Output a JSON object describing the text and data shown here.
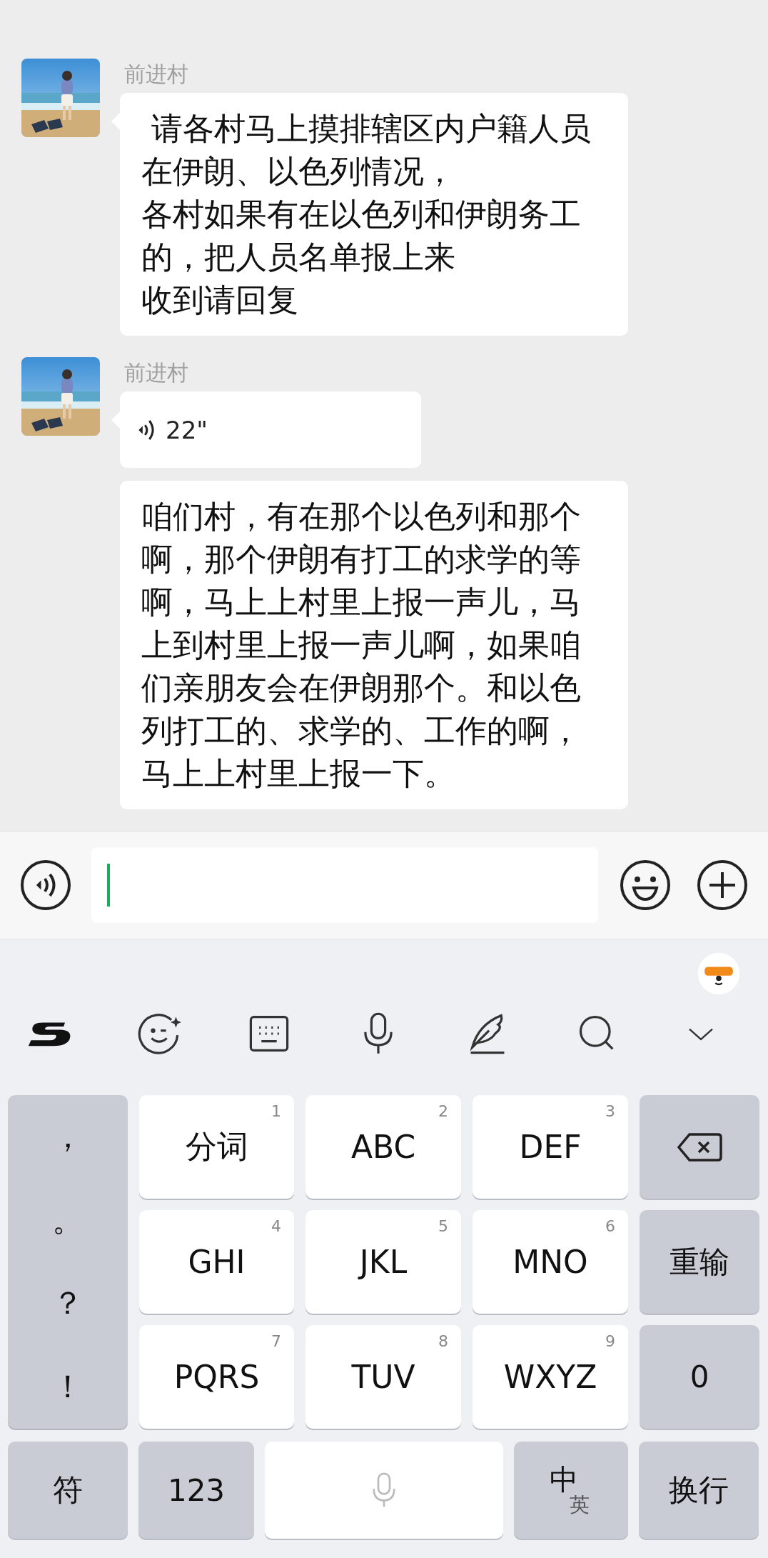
{
  "messages": [
    {
      "kind": "text",
      "sender": "前进村",
      "paragraphs": [
        " 请各村马上摸排辖区内户籍人员在伊朗、以色列情况，",
        "各村如果有在以色列和伊朗务工的，把人员名单报上来",
        "收到请回复"
      ]
    },
    {
      "kind": "voice",
      "sender": "前进村",
      "duration": "22\""
    },
    {
      "kind": "text",
      "paragraphs": [
        "咱们村，有在那个以色列和那个啊，那个伊朗有打工的求学的等啊，马上上村里上报一声儿，马上到村里上报一声儿啊，如果咱们亲朋友会在伊朗那个。和以色列打工的、求学的、工作的啊，马上上村里上报一下。"
      ]
    }
  ],
  "keyboard": {
    "side_symbols": [
      "，",
      "。",
      "？",
      "！"
    ],
    "keys": [
      {
        "label": "分词",
        "digit": "1"
      },
      {
        "label": "ABC",
        "digit": "2"
      },
      {
        "label": "DEF",
        "digit": "3"
      },
      {
        "label": "GHI",
        "digit": "4"
      },
      {
        "label": "JKL",
        "digit": "5"
      },
      {
        "label": "MNO",
        "digit": "6"
      },
      {
        "label": "PQRS",
        "digit": "7"
      },
      {
        "label": "TUV",
        "digit": "8"
      },
      {
        "label": "WXYZ",
        "digit": "9"
      }
    ],
    "right_keys": [
      {
        "kind": "delete"
      },
      {
        "kind": "text",
        "label": "重输"
      },
      {
        "kind": "text",
        "label": "0"
      }
    ],
    "bottom_row": [
      {
        "kind": "text",
        "label": "符"
      },
      {
        "kind": "text",
        "label": "123"
      },
      {
        "kind": "space"
      },
      {
        "kind": "language",
        "main": "中",
        "alt": "英"
      },
      {
        "kind": "text",
        "label": "换行"
      }
    ]
  }
}
